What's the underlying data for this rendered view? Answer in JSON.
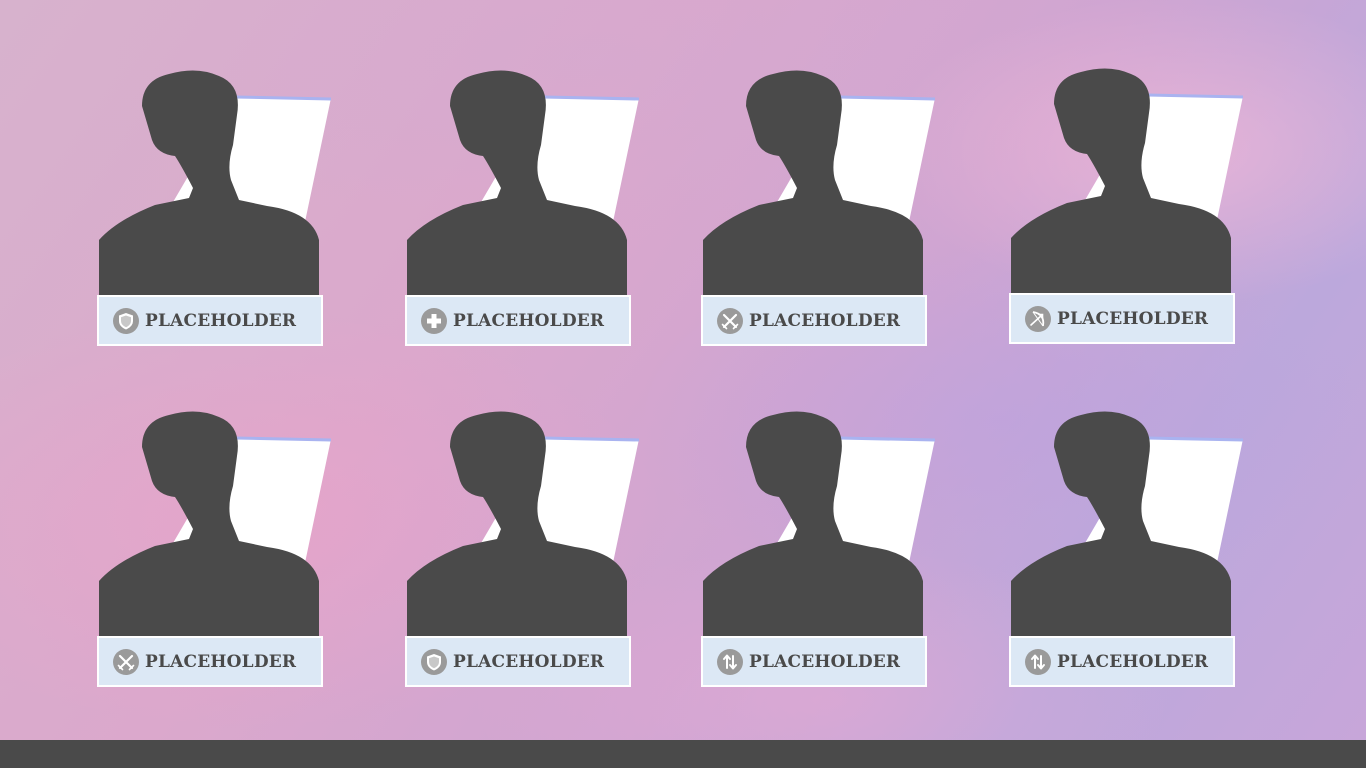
{
  "roster": {
    "cards": [
      {
        "label": "PLACEHOLDER",
        "icon": "shield-icon"
      },
      {
        "label": "PLACEHOLDER",
        "icon": "plus-icon"
      },
      {
        "label": "PLACEHOLDER",
        "icon": "crossed-swords-icon"
      },
      {
        "label": "PLACEHOLDER",
        "icon": "bow-icon"
      },
      {
        "label": "PLACEHOLDER",
        "icon": "crossed-swords-icon"
      },
      {
        "label": "PLACEHOLDER",
        "icon": "shield-icon"
      },
      {
        "label": "PLACEHOLDER",
        "icon": "swap-arrows-icon"
      },
      {
        "label": "PLACEHOLDER",
        "icon": "swap-arrows-icon"
      }
    ]
  },
  "colors": {
    "silhouette": "#4a4a4a",
    "nameplate": "#dce8f5",
    "icon_background": "#9a9a9a",
    "bottom_bar": "#4a4a4a"
  }
}
